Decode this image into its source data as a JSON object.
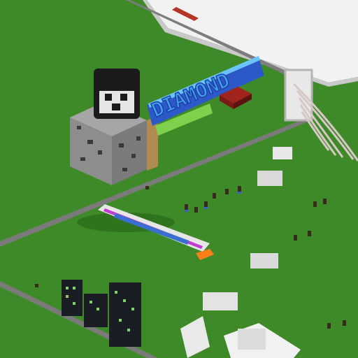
{
  "sign_text": "DIAMOND",
  "colors": {
    "grass": "#3f8a28",
    "grass_light": "#4a9830",
    "path": "#6d6d6d",
    "path_edge": "#9a9a9a",
    "snow": "#f2f2f2",
    "sign_blue": "#3ea0e8",
    "sign_dark": "#1f3fa8",
    "ore_block": "#8d8d8d",
    "wood": "#b08a4e",
    "redstone": "#a0231c",
    "tower_dark": "#1a1d24",
    "tower_window": "#7fd36a"
  },
  "icons": [
    "block-icon",
    "skull-head-icon",
    "diamond-sign-icon",
    "redstone-ore-icon",
    "rail-track-icon",
    "tower-icon",
    "mob-icon"
  ]
}
